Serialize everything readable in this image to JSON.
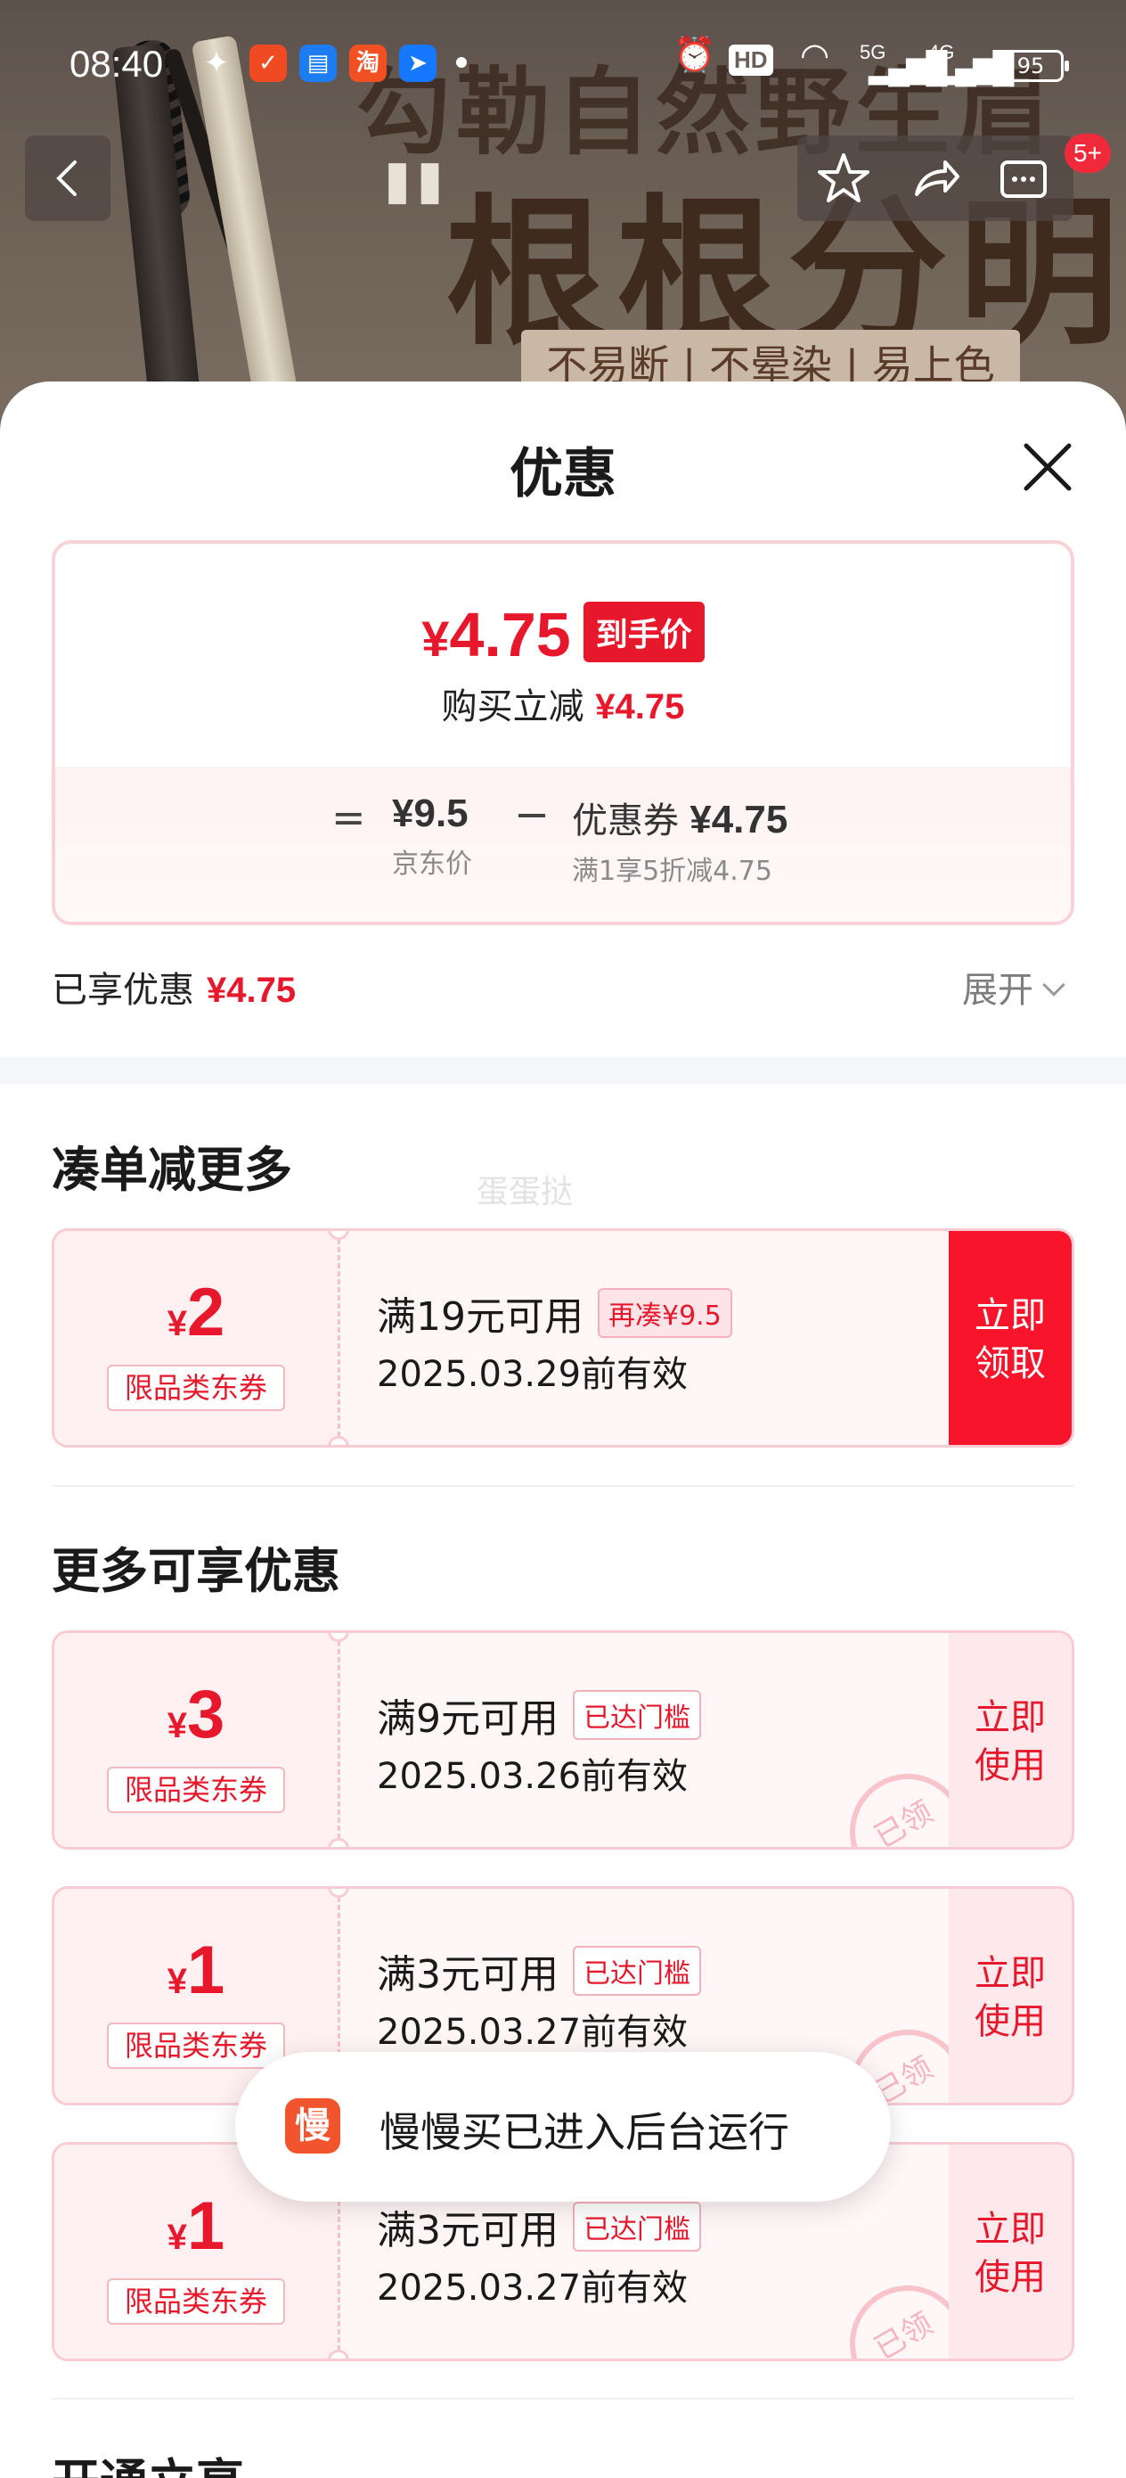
{
  "status_bar": {
    "time": "08:40",
    "icons": [
      "wechat-icon",
      "app-icon",
      "wallet-icon",
      "taobao-icon",
      "app-icon",
      "dot-icon",
      "alarm-icon",
      "hd-icon",
      "wifi-icon",
      "5g-signal-icon",
      "4g-signal-icon"
    ],
    "taobao_glyph": "淘",
    "hd_label": "HD",
    "net_5g": "5G",
    "net_4g": "4G",
    "battery": "95"
  },
  "banner": {
    "slogan_line1": "勾勒自然野生眉",
    "slogan_line2": "根根分明",
    "tagline": "不易断 | 不晕染 | 易上色"
  },
  "nav": {
    "badge": "5+"
  },
  "sheet": {
    "title": "优惠",
    "price": {
      "currency": "¥",
      "amount": "4.75",
      "tag": "到手价",
      "sub_label": "购买立减",
      "sub_amount": "¥4.75"
    },
    "calc": {
      "equals": "=",
      "base_value": "¥9.5",
      "base_caption": "京东价",
      "minus": "−",
      "coupon_label": "优惠券",
      "coupon_value": "¥4.75",
      "coupon_caption": "满1享5折减4.75"
    },
    "enjoyed_label": "已享优惠",
    "enjoyed_amount": "¥4.75",
    "expand_label": "展开",
    "watermark": "蛋蛋挞"
  },
  "sections": {
    "more_savings": {
      "title": "凑单减更多",
      "coupons": [
        {
          "currency": "¥",
          "amount": "2",
          "tag": "限品类东券",
          "condition": "满19元可用",
          "badge": "再凑¥9.5",
          "expiry": "2025.03.29前有效",
          "action_line1": "立即",
          "action_line2": "领取"
        }
      ]
    },
    "more_benefits": {
      "title": "更多可享优惠",
      "coupons": [
        {
          "currency": "¥",
          "amount": "3",
          "tag": "限品类东券",
          "condition": "满9元可用",
          "badge": "已达门槛",
          "expiry": "2025.03.26前有效",
          "action_line1": "立即",
          "action_line2": "使用",
          "stamp": "已领"
        },
        {
          "currency": "¥",
          "amount": "1",
          "tag": "限品类东券",
          "condition": "满3元可用",
          "badge": "已达门槛",
          "expiry": "2025.03.27前有效",
          "action_line1": "立即",
          "action_line2": "使用",
          "stamp": "已领"
        },
        {
          "currency": "¥",
          "amount": "1",
          "tag": "限品类东券",
          "condition": "满3元可用",
          "badge": "已达门槛",
          "expiry": "2025.03.27前有效",
          "action_line1": "立即",
          "action_line2": "使用",
          "stamp": "已领"
        }
      ]
    },
    "next_section_title": "开通立享"
  },
  "toast": {
    "icon_glyph": "慢",
    "text": "慢慢买已进入后台运行"
  },
  "colors": {
    "accent": "#e8182c",
    "coupon_bg": "#fff6f7",
    "coupon_border": "#f9ccd3"
  }
}
